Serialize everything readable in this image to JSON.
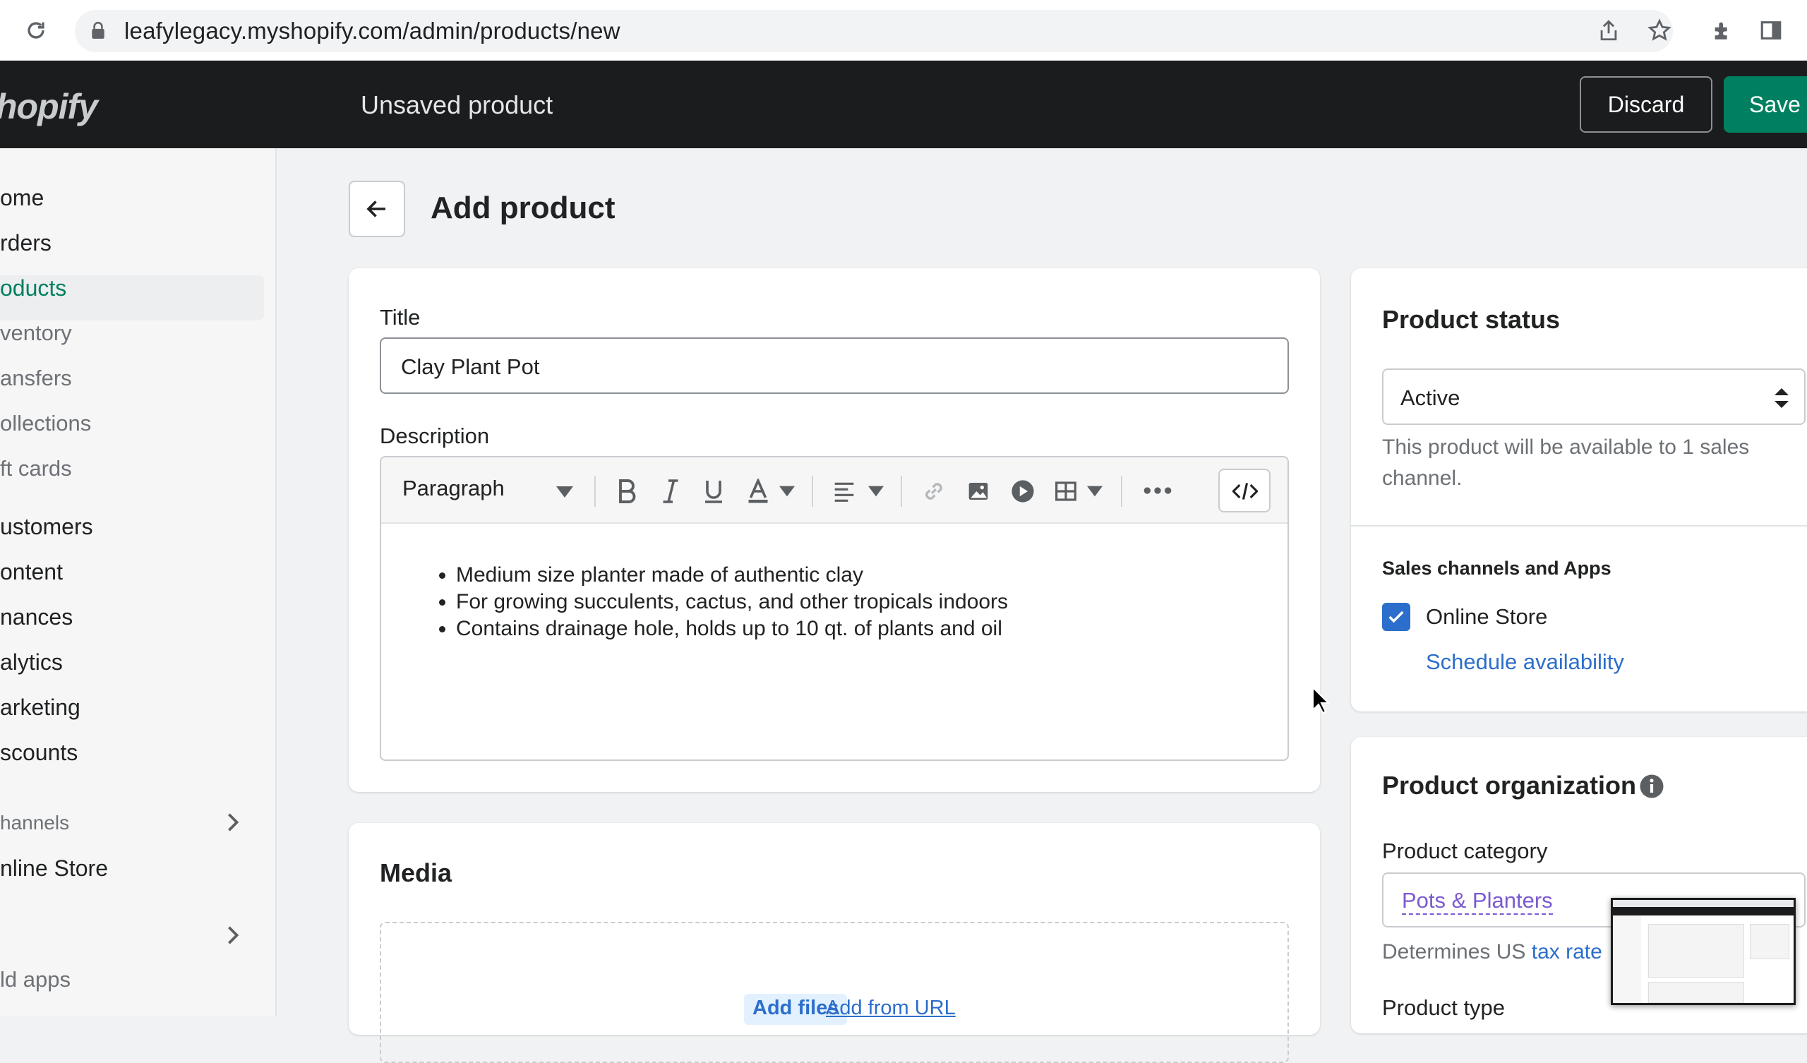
{
  "browser": {
    "url": "leafylegacy.myshopify.com/admin/products/new"
  },
  "topbar": {
    "logo": "hopify",
    "heading": "Unsaved product",
    "discard_label": "Discard",
    "save_label": "Save"
  },
  "sidebar": {
    "items": [
      {
        "label": "ome"
      },
      {
        "label": "rders"
      },
      {
        "label": "oducts"
      },
      {
        "label": "ventory"
      },
      {
        "label": "ansfers"
      },
      {
        "label": "ollections"
      },
      {
        "label": "ft cards"
      },
      {
        "label": "ustomers"
      },
      {
        "label": "ontent"
      },
      {
        "label": "nances"
      },
      {
        "label": "alytics"
      },
      {
        "label": "arketing"
      },
      {
        "label": "scounts"
      }
    ],
    "channels_heading": "hannels",
    "online_store": "nline Store",
    "add_apps": "ld apps"
  },
  "page": {
    "title": "Add product"
  },
  "product": {
    "title_label": "Title",
    "title_value": "Clay Plant Pot",
    "description_label": "Description",
    "paragraph_label": "Paragraph",
    "description_items": [
      "Medium size planter made of authentic clay",
      "For growing succulents, cactus, and other tropicals indoors",
      "Contains drainage hole, holds up to 10 qt. of plants and oil"
    ]
  },
  "media": {
    "title": "Media",
    "add_files": "Add files",
    "add_from_url": "Add from URL"
  },
  "status": {
    "title": "Product status",
    "value": "Active",
    "help": "This product will be available to 1 sales channel.",
    "sales_heading": "Sales channels and Apps",
    "online_store_label": "Online Store",
    "schedule_label": "Schedule availability"
  },
  "organization": {
    "title": "Product organization",
    "category_label": "Product category",
    "category_value": "Pots & Planters",
    "category_help": "Determines US",
    "tax_link": "tax rate",
    "type_label": "Product type"
  },
  "colors": {
    "accent": "#008060",
    "link": "#2c6ecb",
    "topbar": "#1a1c1d"
  }
}
